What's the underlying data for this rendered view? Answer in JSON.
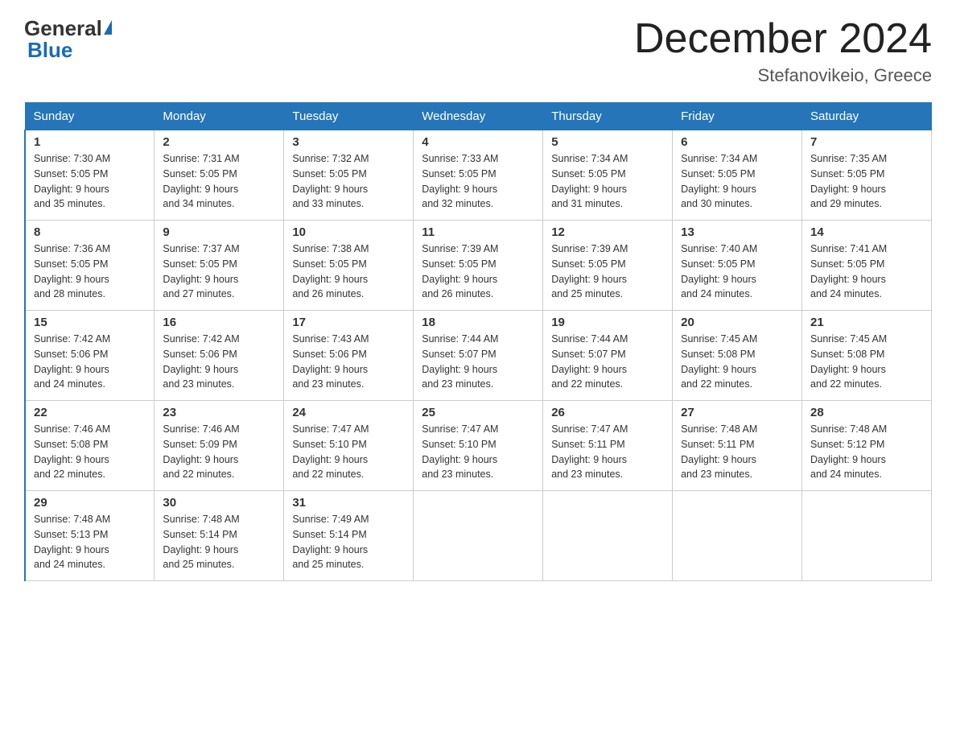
{
  "header": {
    "logo_general": "General",
    "logo_blue": "Blue",
    "month_year": "December 2024",
    "location": "Stefanovikeio, Greece"
  },
  "days_of_week": [
    "Sunday",
    "Monday",
    "Tuesday",
    "Wednesday",
    "Thursday",
    "Friday",
    "Saturday"
  ],
  "weeks": [
    [
      {
        "day": "1",
        "sunrise": "7:30 AM",
        "sunset": "5:05 PM",
        "daylight": "9 hours and 35 minutes."
      },
      {
        "day": "2",
        "sunrise": "7:31 AM",
        "sunset": "5:05 PM",
        "daylight": "9 hours and 34 minutes."
      },
      {
        "day": "3",
        "sunrise": "7:32 AM",
        "sunset": "5:05 PM",
        "daylight": "9 hours and 33 minutes."
      },
      {
        "day": "4",
        "sunrise": "7:33 AM",
        "sunset": "5:05 PM",
        "daylight": "9 hours and 32 minutes."
      },
      {
        "day": "5",
        "sunrise": "7:34 AM",
        "sunset": "5:05 PM",
        "daylight": "9 hours and 31 minutes."
      },
      {
        "day": "6",
        "sunrise": "7:34 AM",
        "sunset": "5:05 PM",
        "daylight": "9 hours and 30 minutes."
      },
      {
        "day": "7",
        "sunrise": "7:35 AM",
        "sunset": "5:05 PM",
        "daylight": "9 hours and 29 minutes."
      }
    ],
    [
      {
        "day": "8",
        "sunrise": "7:36 AM",
        "sunset": "5:05 PM",
        "daylight": "9 hours and 28 minutes."
      },
      {
        "day": "9",
        "sunrise": "7:37 AM",
        "sunset": "5:05 PM",
        "daylight": "9 hours and 27 minutes."
      },
      {
        "day": "10",
        "sunrise": "7:38 AM",
        "sunset": "5:05 PM",
        "daylight": "9 hours and 26 minutes."
      },
      {
        "day": "11",
        "sunrise": "7:39 AM",
        "sunset": "5:05 PM",
        "daylight": "9 hours and 26 minutes."
      },
      {
        "day": "12",
        "sunrise": "7:39 AM",
        "sunset": "5:05 PM",
        "daylight": "9 hours and 25 minutes."
      },
      {
        "day": "13",
        "sunrise": "7:40 AM",
        "sunset": "5:05 PM",
        "daylight": "9 hours and 24 minutes."
      },
      {
        "day": "14",
        "sunrise": "7:41 AM",
        "sunset": "5:05 PM",
        "daylight": "9 hours and 24 minutes."
      }
    ],
    [
      {
        "day": "15",
        "sunrise": "7:42 AM",
        "sunset": "5:06 PM",
        "daylight": "9 hours and 24 minutes."
      },
      {
        "day": "16",
        "sunrise": "7:42 AM",
        "sunset": "5:06 PM",
        "daylight": "9 hours and 23 minutes."
      },
      {
        "day": "17",
        "sunrise": "7:43 AM",
        "sunset": "5:06 PM",
        "daylight": "9 hours and 23 minutes."
      },
      {
        "day": "18",
        "sunrise": "7:44 AM",
        "sunset": "5:07 PM",
        "daylight": "9 hours and 23 minutes."
      },
      {
        "day": "19",
        "sunrise": "7:44 AM",
        "sunset": "5:07 PM",
        "daylight": "9 hours and 22 minutes."
      },
      {
        "day": "20",
        "sunrise": "7:45 AM",
        "sunset": "5:08 PM",
        "daylight": "9 hours and 22 minutes."
      },
      {
        "day": "21",
        "sunrise": "7:45 AM",
        "sunset": "5:08 PM",
        "daylight": "9 hours and 22 minutes."
      }
    ],
    [
      {
        "day": "22",
        "sunrise": "7:46 AM",
        "sunset": "5:08 PM",
        "daylight": "9 hours and 22 minutes."
      },
      {
        "day": "23",
        "sunrise": "7:46 AM",
        "sunset": "5:09 PM",
        "daylight": "9 hours and 22 minutes."
      },
      {
        "day": "24",
        "sunrise": "7:47 AM",
        "sunset": "5:10 PM",
        "daylight": "9 hours and 22 minutes."
      },
      {
        "day": "25",
        "sunrise": "7:47 AM",
        "sunset": "5:10 PM",
        "daylight": "9 hours and 23 minutes."
      },
      {
        "day": "26",
        "sunrise": "7:47 AM",
        "sunset": "5:11 PM",
        "daylight": "9 hours and 23 minutes."
      },
      {
        "day": "27",
        "sunrise": "7:48 AM",
        "sunset": "5:11 PM",
        "daylight": "9 hours and 23 minutes."
      },
      {
        "day": "28",
        "sunrise": "7:48 AM",
        "sunset": "5:12 PM",
        "daylight": "9 hours and 24 minutes."
      }
    ],
    [
      {
        "day": "29",
        "sunrise": "7:48 AM",
        "sunset": "5:13 PM",
        "daylight": "9 hours and 24 minutes."
      },
      {
        "day": "30",
        "sunrise": "7:48 AM",
        "sunset": "5:14 PM",
        "daylight": "9 hours and 25 minutes."
      },
      {
        "day": "31",
        "sunrise": "7:49 AM",
        "sunset": "5:14 PM",
        "daylight": "9 hours and 25 minutes."
      },
      null,
      null,
      null,
      null
    ]
  ],
  "labels": {
    "sunrise": "Sunrise:",
    "sunset": "Sunset:",
    "daylight": "Daylight:"
  }
}
